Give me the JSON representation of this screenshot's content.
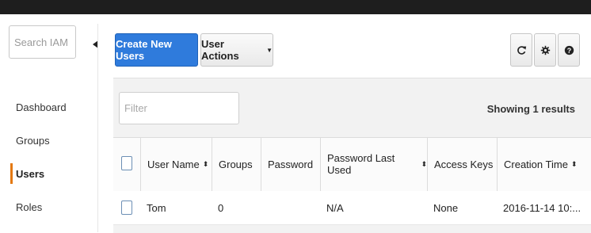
{
  "sidebar": {
    "search_placeholder": "Search IAM",
    "items": [
      {
        "label": "Dashboard"
      },
      {
        "label": "Groups"
      },
      {
        "label": "Users",
        "active": true
      },
      {
        "label": "Roles"
      }
    ]
  },
  "toolbar": {
    "create_label": "Create New Users",
    "actions_label": "User Actions",
    "icons": [
      "refresh-icon",
      "gear-icon",
      "help-icon"
    ]
  },
  "filter": {
    "placeholder": "Filter",
    "results_text": "Showing 1 results"
  },
  "table": {
    "columns": [
      {
        "label": "User Name",
        "sortable": true
      },
      {
        "label": "Groups",
        "sortable": false
      },
      {
        "label": "Password",
        "sortable": false
      },
      {
        "label": "Password Last Used",
        "sortable": true
      },
      {
        "label": "Access Keys",
        "sortable": false
      },
      {
        "label": "Creation Time",
        "sortable": true
      }
    ],
    "rows": [
      {
        "user_name": "Tom",
        "groups": "0",
        "password": "",
        "password_last_used": "N/A",
        "access_keys": "None",
        "creation_time": "2016-11-14 10:..."
      }
    ]
  },
  "colors": {
    "primary": "#2f7bdc",
    "active_nav": "#e47911",
    "topbar": "#1e1e1e"
  }
}
